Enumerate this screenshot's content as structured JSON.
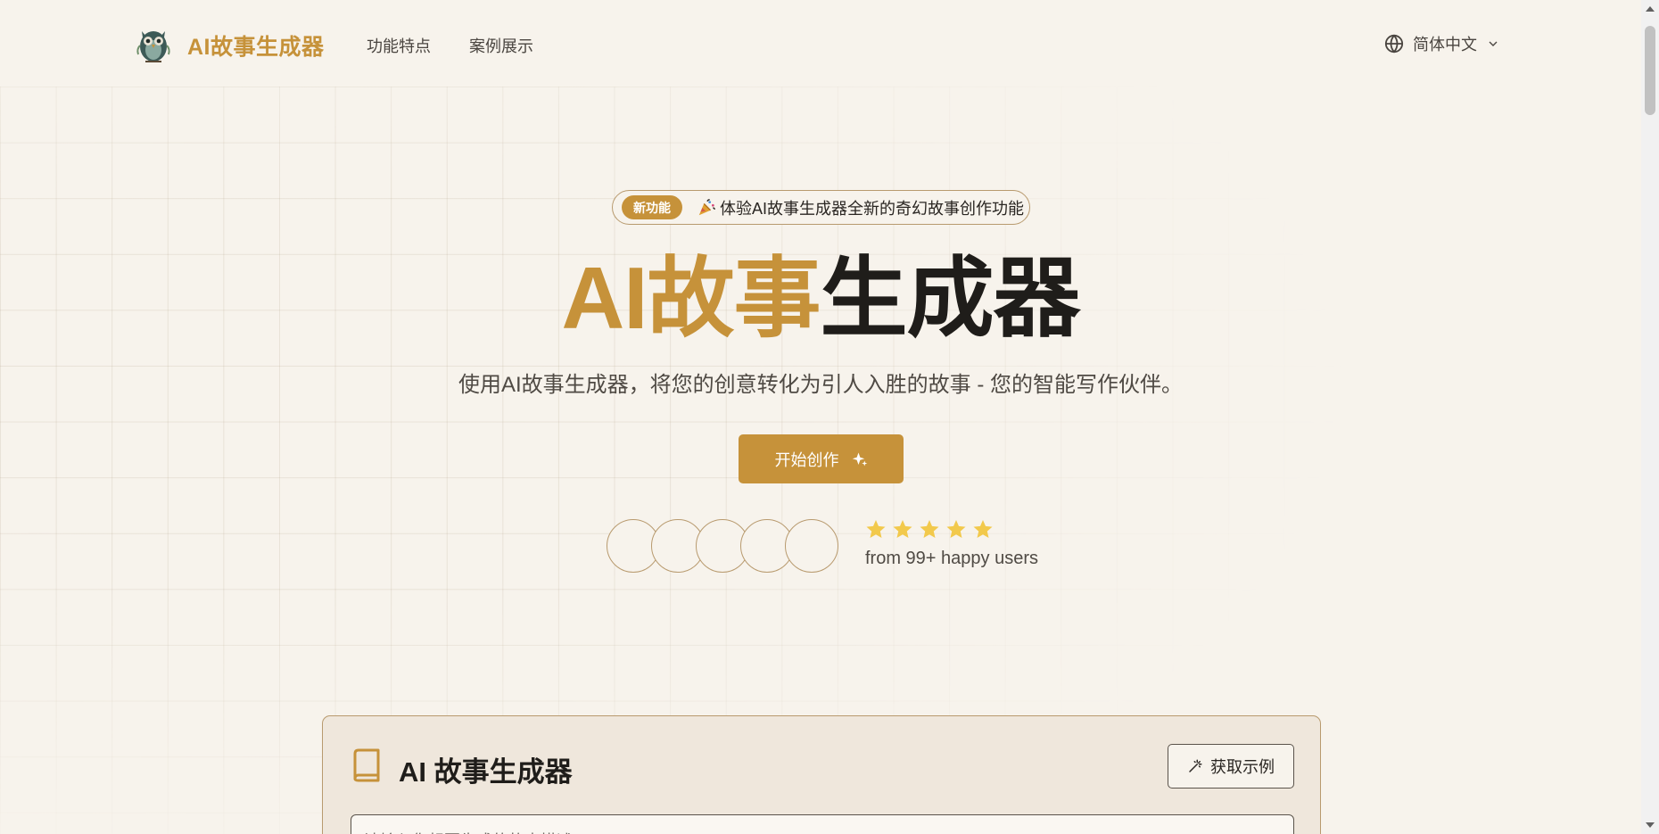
{
  "header": {
    "brand": "AI故事生成器",
    "nav": [
      {
        "label": "功能特点"
      },
      {
        "label": "案例展示"
      }
    ],
    "language": {
      "selected": "简体中文",
      "icon": "globe-icon"
    }
  },
  "hero": {
    "badge": {
      "pill": "新功能",
      "icon": "party-popper",
      "text": "体验AI故事生成器全新的奇幻故事创作功能"
    },
    "title_accent": "AI故事",
    "title_rest": "生成器",
    "subtitle": "使用AI故事生成器，将您的创意转化为引人入胜的故事 - 您的智能写作伙伴。",
    "cta": {
      "label": "开始创作",
      "icon": "sparkle-icon"
    },
    "social_proof": {
      "avatar_count": 5,
      "rating": 5,
      "rating_max": 5,
      "text": "from 99+ happy users"
    }
  },
  "generator": {
    "title": "AI 故事生成器",
    "icon": "book-icon",
    "example_button": "获取示例",
    "input_placeholder": "请输入您想要生成的故事描述..."
  },
  "colors": {
    "accent": "#c6923a",
    "background": "#f7f3ec",
    "card": "#efe7dc",
    "star": "#f2c94c",
    "border": "#b89a6e"
  }
}
